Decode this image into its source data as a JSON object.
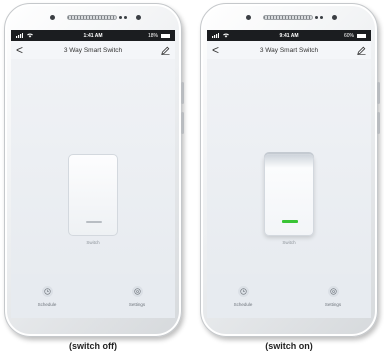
{
  "phones": [
    {
      "status_time": "1:41 AM",
      "battery": "18%",
      "title": "3 Way Smart Switch",
      "back": "<",
      "switch_label": "Switch",
      "switch_state": "off",
      "schedule_label": "Schedule",
      "settings_label": "Settings",
      "caption": "(switch off)"
    },
    {
      "status_time": "9:41 AM",
      "battery": "60%",
      "title": "3 Way Smart Switch",
      "back": "<",
      "switch_label": "Switch",
      "switch_state": "on",
      "schedule_label": "Schedule",
      "settings_label": "Settings",
      "caption": "(switch on)"
    }
  ],
  "colors": {
    "indicator_on": "#39c435",
    "indicator_off": "#b8bdc3",
    "status_bar": "#1b1d20"
  },
  "icons": [
    "signal-icon",
    "wifi-icon",
    "battery-icon",
    "back-arrow-icon",
    "edit-pencil-icon",
    "schedule-clock-icon",
    "settings-gear-icon"
  ]
}
